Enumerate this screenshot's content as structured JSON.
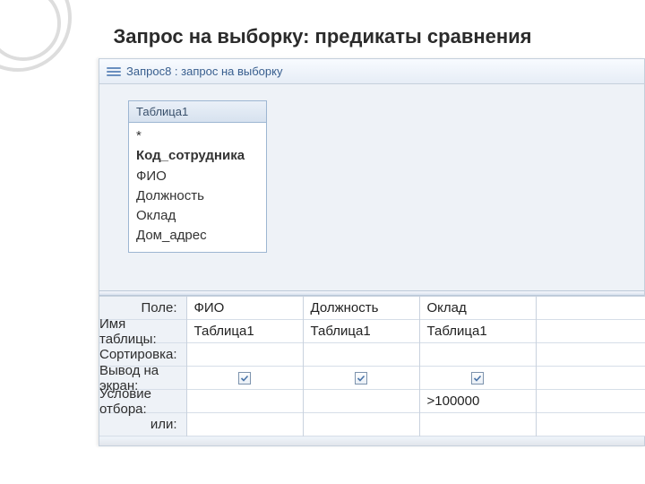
{
  "slide": {
    "title": "Запрос на выборку: предикаты сравнения"
  },
  "window": {
    "title": "Запрос8 : запрос на выборку"
  },
  "table_card": {
    "name": "Таблица1",
    "fields": [
      "*",
      "Код_сотрудника",
      "ФИО",
      "Должность",
      "Оклад",
      "Дом_адрес"
    ],
    "bold_index": 1
  },
  "qbe": {
    "labels": [
      "Поле:",
      "Имя таблицы:",
      "Сортировка:",
      "Вывод на экран:",
      "Условие отбора:",
      "или:"
    ],
    "columns": [
      {
        "field": "ФИО",
        "table": "Таблица1",
        "sort": "",
        "show": true,
        "criteria": "",
        "or": ""
      },
      {
        "field": "Должность",
        "table": "Таблица1",
        "sort": "",
        "show": true,
        "criteria": "",
        "or": ""
      },
      {
        "field": "Оклад",
        "table": "Таблица1",
        "sort": "",
        "show": true,
        "criteria": ">100000",
        "or": ""
      }
    ]
  }
}
